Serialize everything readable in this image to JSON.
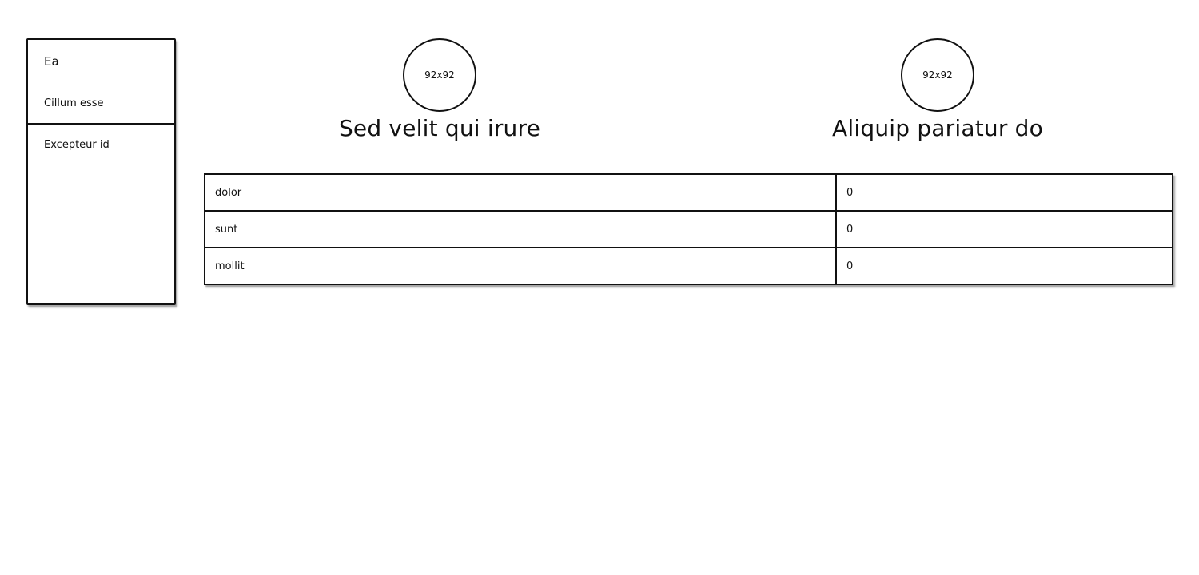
{
  "sidebar": {
    "title": "Ea",
    "subtitle": "Cillum esse",
    "items": [
      {
        "label": "Excepteur id"
      }
    ]
  },
  "profiles": [
    {
      "avatar_label": "92x92",
      "name": "Sed velit qui irure"
    },
    {
      "avatar_label": "92x92",
      "name": "Aliquip pariatur do"
    }
  ],
  "table": {
    "rows": [
      {
        "key": "dolor",
        "value": "0"
      },
      {
        "key": "sunt",
        "value": "0"
      },
      {
        "key": "mollit",
        "value": "0"
      }
    ]
  }
}
